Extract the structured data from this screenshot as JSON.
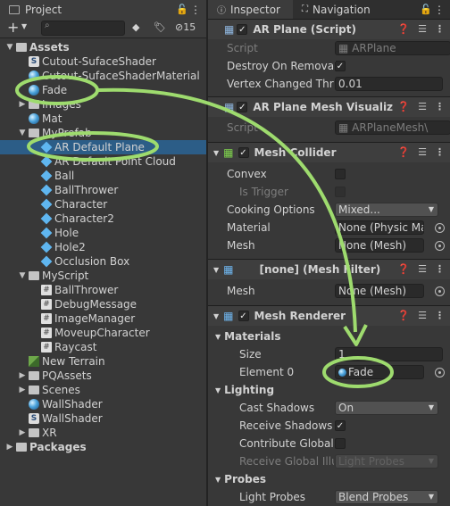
{
  "project_panel": {
    "tab_label": "Project",
    "hidden_count": "15",
    "search_placeholder": "",
    "tree": [
      {
        "label": "Assets",
        "depth": 0,
        "icon": "folder-icon",
        "fold": "▼",
        "bold": true
      },
      {
        "label": "Cutout-SufaceShader",
        "depth": 1,
        "icon": "shader-icon"
      },
      {
        "label": "Cutout-SufaceShaderMaterial",
        "depth": 1,
        "icon": "material-icon"
      },
      {
        "label": "Fade",
        "depth": 1,
        "icon": "material-icon"
      },
      {
        "label": "Images",
        "depth": 1,
        "icon": "folder-icon",
        "fold": "▶"
      },
      {
        "label": "Mat",
        "depth": 1,
        "icon": "material-icon"
      },
      {
        "label": "MyPrefab",
        "depth": 1,
        "icon": "folder-icon",
        "fold": "▼"
      },
      {
        "label": "AR Default Plane",
        "depth": 2,
        "icon": "prefab-icon",
        "selected": true
      },
      {
        "label": "AR Default Point Cloud",
        "depth": 2,
        "icon": "prefab-icon"
      },
      {
        "label": "Ball",
        "depth": 2,
        "icon": "prefab-icon"
      },
      {
        "label": "BallThrower",
        "depth": 2,
        "icon": "prefab-icon"
      },
      {
        "label": "Character",
        "depth": 2,
        "icon": "prefab-icon"
      },
      {
        "label": "Character2",
        "depth": 2,
        "icon": "prefab-icon"
      },
      {
        "label": "Hole",
        "depth": 2,
        "icon": "prefab-icon"
      },
      {
        "label": "Hole2",
        "depth": 2,
        "icon": "prefab-icon"
      },
      {
        "label": "Occlusion Box",
        "depth": 2,
        "icon": "prefab-icon"
      },
      {
        "label": "MyScript",
        "depth": 1,
        "icon": "folder-icon",
        "fold": "▼"
      },
      {
        "label": "BallThrower",
        "depth": 2,
        "icon": "script-icon"
      },
      {
        "label": "DebugMessage",
        "depth": 2,
        "icon": "script-icon"
      },
      {
        "label": "ImageManager",
        "depth": 2,
        "icon": "script-icon"
      },
      {
        "label": "MoveupCharacter",
        "depth": 2,
        "icon": "script-icon"
      },
      {
        "label": "Raycast",
        "depth": 2,
        "icon": "script-icon"
      },
      {
        "label": "New Terrain",
        "depth": 1,
        "icon": "terrain-icon"
      },
      {
        "label": "PQAssets",
        "depth": 1,
        "icon": "folder-icon",
        "fold": "▶"
      },
      {
        "label": "Scenes",
        "depth": 1,
        "icon": "folder-icon",
        "fold": "▶"
      },
      {
        "label": "WallShader",
        "depth": 1,
        "icon": "material-icon"
      },
      {
        "label": "WallShader",
        "depth": 1,
        "icon": "shader-icon"
      },
      {
        "label": "XR",
        "depth": 1,
        "icon": "folder-icon",
        "fold": "▶"
      },
      {
        "label": "Packages",
        "depth": 0,
        "icon": "folder-icon",
        "fold": "▶",
        "bold": true
      }
    ]
  },
  "inspector": {
    "tab_inspector": "Inspector",
    "tab_navigation": "Navigation",
    "ar_plane": {
      "title": "AR Plane (Script)",
      "script_label": "Script",
      "script_value": "ARPlane",
      "destroy_label": "Destroy On Removal",
      "vertex_label": "Vertex Changed Thre",
      "vertex_value": "0.01"
    },
    "ar_plane_mesh": {
      "title": "AR Plane Mesh Visualiz",
      "script_label": "Script",
      "script_value": "ARPlaneMesh\\"
    },
    "mesh_collider": {
      "title": "Mesh Collider",
      "convex_label": "Convex",
      "trigger_label": "Is Trigger",
      "cooking_label": "Cooking Options",
      "cooking_value": "Mixed...",
      "material_label": "Material",
      "material_value": "None (Physic Ma",
      "mesh_label": "Mesh",
      "mesh_value": "None (Mesh)"
    },
    "mesh_filter": {
      "title": "[none] (Mesh Filter)",
      "mesh_label": "Mesh",
      "mesh_value": "None (Mesh)"
    },
    "mesh_renderer": {
      "title": "Mesh Renderer",
      "materials_label": "Materials",
      "size_label": "Size",
      "size_value": "1",
      "element_label": "Element 0",
      "element_value": "Fade",
      "lighting_label": "Lighting",
      "cast_label": "Cast Shadows",
      "cast_value": "On",
      "receive_label": "Receive Shadows",
      "contribute_label": "Contribute Global I",
      "receive_gi_label": "Receive Global Illu",
      "receive_gi_value": "Light Probes",
      "probes_label": "Probes",
      "light_probes_label": "Light Probes",
      "light_probes_value": "Blend Probes"
    }
  },
  "colors": {
    "annotation": "#9edb6e",
    "selection": "#2c5d87"
  }
}
